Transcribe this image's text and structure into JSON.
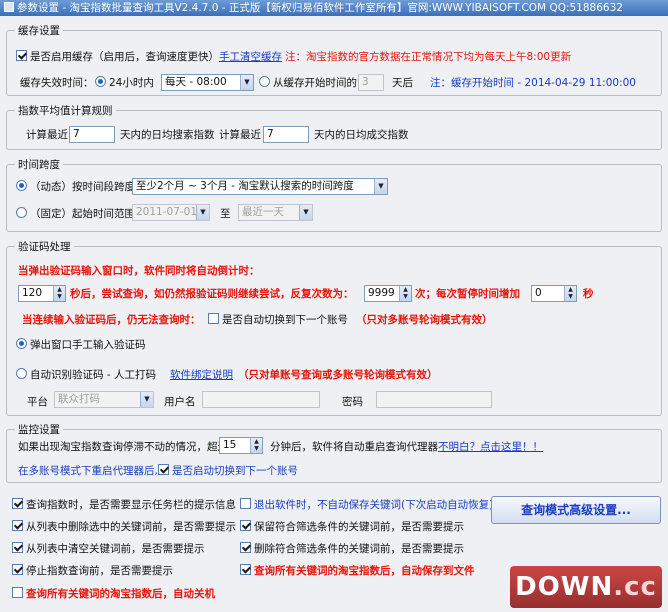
{
  "window": {
    "title": "参数设置 - 淘宝指数批量查询工具V2.4.7.0 - 正式版【新权归易佰软件工作室所有】官网:WWW.YIBAISOFT.COM QQ:51886632"
  },
  "cache": {
    "legend": "缓存设置",
    "enable_label": "是否启用缓存（启用后，查询速度更快）",
    "clear_link": "手工清空缓存",
    "note": "注：淘宝指数的官方数据在正常情况下均为每天上午8:00更新",
    "expire_label": "缓存失效时间：",
    "opt_24h": "24小时内",
    "daily_value": "每天 - 08:00",
    "opt_from_start": "从缓存开始时间的",
    "days_value": "3",
    "days_after": "天后",
    "start_note": "注：缓存开始时间 - 2014-04-29 11:00:00"
  },
  "avg": {
    "legend": "指数平均值计算规则",
    "calc_label_1": "计算最近",
    "search_days": "7",
    "search_suffix": "天内的日均搜索指数",
    "calc_label_2": "计算最近",
    "deal_days": "7",
    "deal_suffix": "天内的日均成交指数"
  },
  "span": {
    "legend": "时间跨度",
    "dynamic_label": "（动态）按时间段跨度",
    "dynamic_value": "至少2个月 ~ 3个月 - 淘宝默认搜索的时间跨度",
    "fixed_label": "（固定）起始时间范围",
    "fixed_from": "2011-07-01",
    "to": "至",
    "fixed_to": "最近一天"
  },
  "captcha": {
    "legend": "验证码处理",
    "intro": "当弹出验证码输入窗口时，软件同时将自动倒计时：",
    "seconds_value": "120",
    "retry_text": "秒后，尝试查询，如仍然报验证码则继续尝试，反复次数为：",
    "retry_value": "9999",
    "increase_text": "次；每次暂停时间增加",
    "increase_value": "0",
    "sec_unit": "秒",
    "fail_text": "当连续输入验证码后，仍无法查询时：",
    "switch_label": "是否自动切换到下一个账号",
    "switch_note": "（只对多账号轮询模式有效）",
    "manual_label": "弹出窗口手工输入验证码",
    "auto_label": "自动识别验证码 - 人工打码",
    "bind_link": "软件绑定说明",
    "auto_note": "（只对单账号查询或多账号轮询模式有效）",
    "platform_label": "平台",
    "platform_value": "联众打码",
    "user_label": "用户名",
    "pass_label": "密码"
  },
  "monitor": {
    "legend": "监控设置",
    "text_before": "如果出现淘宝指数查询停滞不动的情况，超过",
    "minutes": "15",
    "text_after": "分钟后，软件将自动重启查询代理器",
    "help_link": "不明白？点击这里！！",
    "multi_label": "在多账号模式下重启代理器后,",
    "switch_label": "是否启动切换到下一个账号"
  },
  "options": {
    "o1": "查询指数时，是否需要显示任务栏的提示信息",
    "o2": "退出软件时，不自动保存关键词(下次启动自动恢复)",
    "o3": "从列表中删除选中的关键词前，是否需要提示",
    "o4": "保留符合筛选条件的关键词前，是否需要提示",
    "o5": "从列表中清空关键词前，是否需要提示",
    "o6": "删除符合筛选条件的关键词前，是否需要提示",
    "o7": "停止指数查询前，是否需要提示",
    "o8": "查询所有关键词的淘宝指数后，自动保存到文件",
    "o9": "查询所有关键词的淘宝指数后，自动关机",
    "advanced_button": "查询模式高级设置..."
  },
  "watermark": {
    "brand": "DOWN",
    "tld": ".cc"
  },
  "colors": {
    "accent_red": "#e8160c",
    "link_blue": "#1a3dc4",
    "titlebar": "#3b6fb8"
  }
}
